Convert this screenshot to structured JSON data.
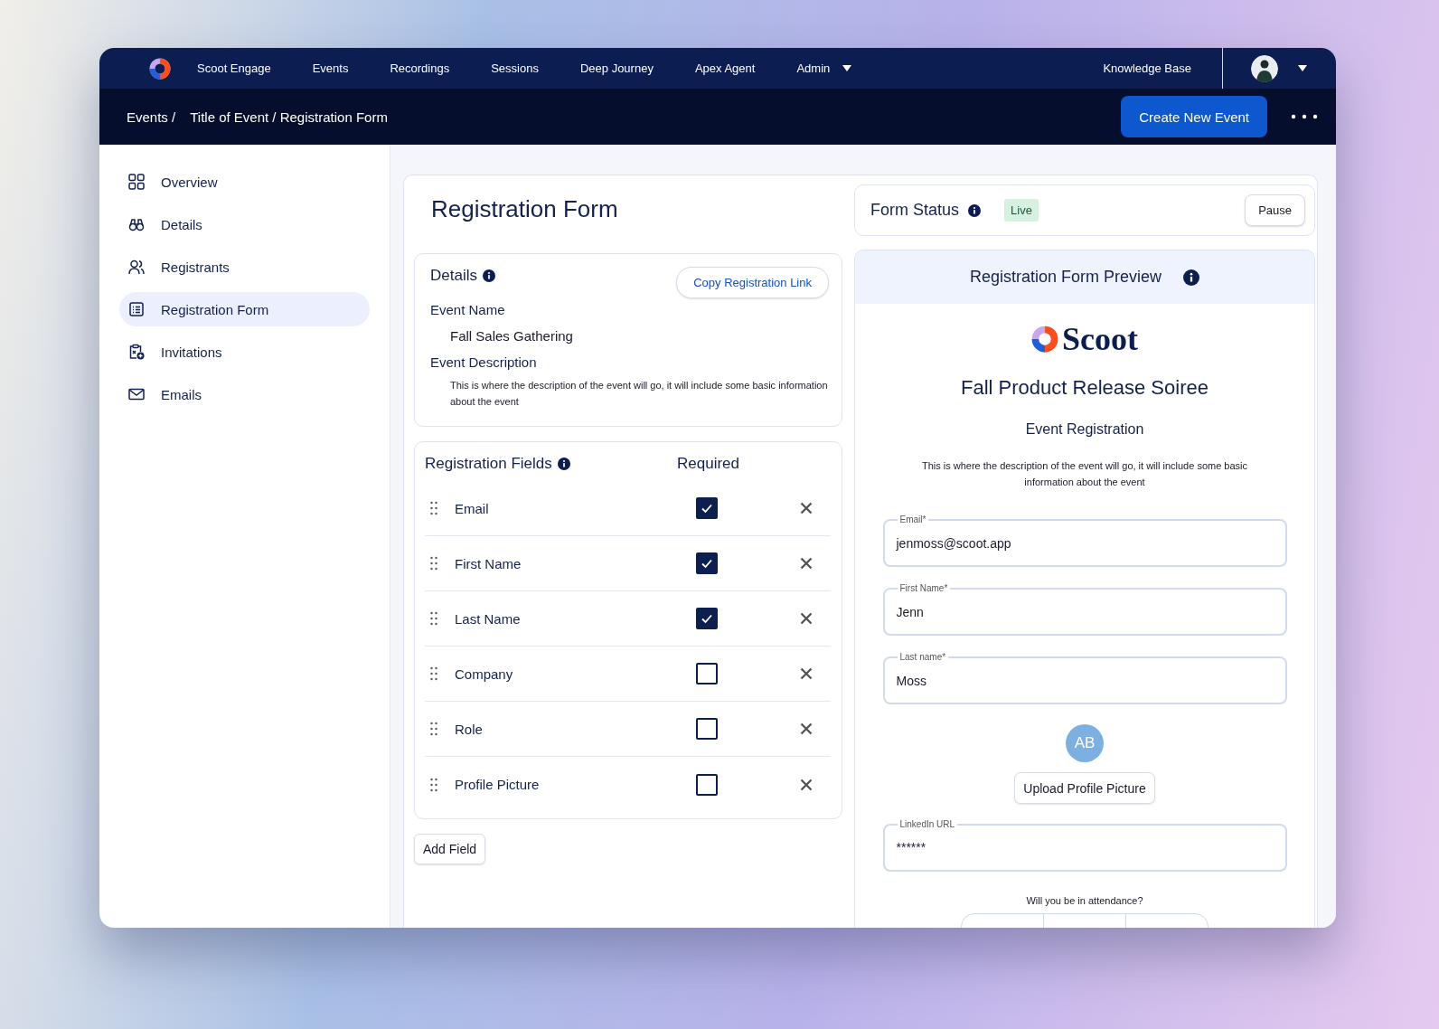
{
  "nav": {
    "items": [
      "Scoot Engage",
      "Events",
      "Recordings",
      "Sessions",
      "Deep Journey",
      "Apex Agent"
    ],
    "admin": "Admin",
    "help_link": "Knowledge Base"
  },
  "breadcrumb": [
    "Events /",
    "Title of Event / Registration Form"
  ],
  "primary_action": "Create New Event",
  "sidebar": {
    "items": [
      {
        "label": "Overview",
        "kind": "grid",
        "selected": false
      },
      {
        "label": "Details",
        "kind": "binoculars",
        "selected": false
      },
      {
        "label": "Registrants",
        "kind": "people",
        "selected": false
      },
      {
        "label": "Registration Form",
        "kind": "form",
        "selected": true
      },
      {
        "label": "Invitations",
        "kind": "invite",
        "selected": false
      },
      {
        "label": "Emails",
        "kind": "mail",
        "selected": false
      }
    ]
  },
  "page_title": "Registration Form",
  "details": {
    "title": "Details",
    "copy_link": "Copy Registration Link",
    "event_name_label": "Event Name",
    "event_name": "Fall Sales Gathering",
    "description_label": "Event Description",
    "description": "This is where the description of the event will go, it will include some basic information about the event"
  },
  "fields": {
    "title": "Registration Fields",
    "required_heading": "Required",
    "rows": [
      {
        "label": "Email",
        "required": true
      },
      {
        "label": "First Name",
        "required": true
      },
      {
        "label": "Last Name",
        "required": true
      },
      {
        "label": "Company",
        "required": false
      },
      {
        "label": "Role",
        "required": false
      },
      {
        "label": "Profile Picture",
        "required": false
      }
    ]
  },
  "add_field": "Add Field",
  "form_status": {
    "label": "Form Status",
    "status": "Live",
    "action": "Pause"
  },
  "preview": {
    "title": "Registration Form Preview",
    "brand": "Scoot",
    "event_title": "Fall Product Release Soiree",
    "subtitle": "Event Registration",
    "description": "This is where the description of the event will go, it will include some basic information about the event",
    "inputs": [
      {
        "label": "Email*",
        "value": "jenmoss@scoot.app"
      },
      {
        "label": "First Name*",
        "value": "Jenn"
      },
      {
        "label": "Last name*",
        "value": "Moss"
      }
    ],
    "avatar_initials": "AB",
    "upload": "Upload Profile Picture",
    "linkedin": {
      "label": "LinkedIn URL",
      "value": "******"
    },
    "attendance_question": "Will you be in attendance?"
  }
}
